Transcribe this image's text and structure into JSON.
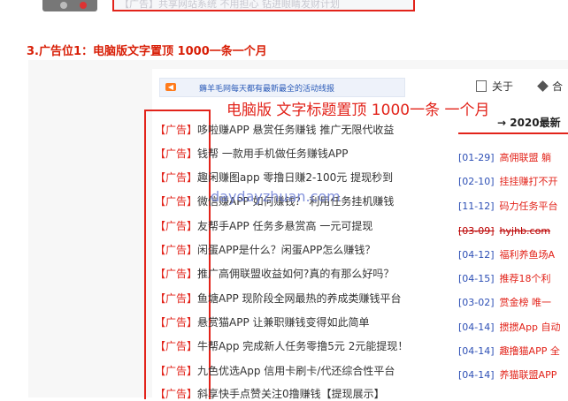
{
  "top": {
    "banner_text": "【广告】共享网站系统 不用担心 钻进眼睛发财计划"
  },
  "section_title": "3.广告位1：电脑版文字置顶 1000一条一个月",
  "screenshot": {
    "notice": {
      "text": "薅羊毛网每天都有最新最全的活动线报"
    },
    "nav": {
      "about_label": "关于",
      "tag_label": "合"
    },
    "overlay_label": "电脑版 文字标题置顶 1000一条 一个月",
    "watermark": "daydayzhuan.com",
    "ad_tag": "【广告】",
    "ads": [
      "哆啦赚APP 悬赏任务赚钱 推广无限代收益",
      "钱帮 一款用手机做任务赚钱APP",
      "趣闲赚图app 零撸日赚2-100元 提现秒到",
      "微信赚APP 如何赚钱？ 利用任务挂机赚钱",
      "友帮手APP 任务多悬赏高 一元可提现",
      "闲蛋APP是什么？闲蛋APP怎么赚钱？",
      "推广高佣联盟收益如何?真的有那么好吗？",
      "鱼塘APP 现阶段全网最热的养成类赚钱平台",
      "悬赏猫APP 让兼职赚钱变得如此简单",
      "牛帮App 完成新人任务零撸5元 2元能提现！",
      "九色优选App 信用卡刷卡/代还综合性平台",
      "斜享快手点赞关注0撸赚钱【提现展示】"
    ],
    "right": {
      "heading": "→  2020最新",
      "news": [
        {
          "date": "[01-29]",
          "title": "高佣联盟 躺"
        },
        {
          "date": "[02-10]",
          "title": "挂挂赚打不开"
        },
        {
          "date": "[11-12]",
          "title": "码力任务平台"
        },
        {
          "date": "[03-09]",
          "title": "hyjhb.com"
        },
        {
          "date": "[04-12]",
          "title": "福利养鱼场A"
        },
        {
          "date": "[04-15]",
          "title": "推荐18个利"
        },
        {
          "date": "[03-02]",
          "title": "赏金榜 唯一"
        },
        {
          "date": "[04-14]",
          "title": "掼掼App 自动"
        },
        {
          "date": "[04-14]",
          "title": "趣撸猫APP 全"
        },
        {
          "date": "[04-14]",
          "title": "养猫联盟APP"
        }
      ]
    }
  }
}
